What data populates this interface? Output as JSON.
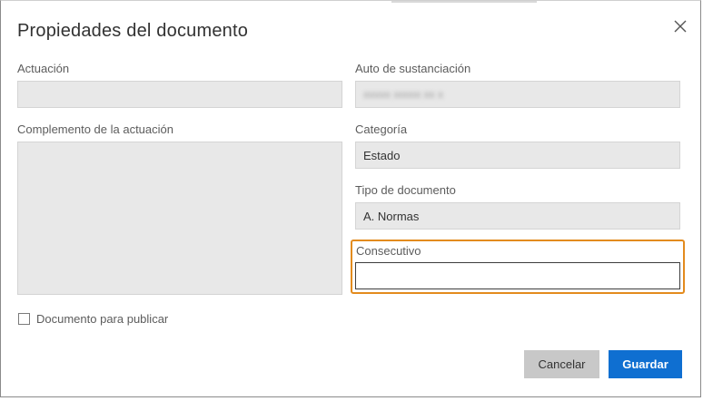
{
  "dialog": {
    "title": "Propiedades del documento"
  },
  "fields": {
    "actuacion": {
      "label": "Actuación",
      "value": ""
    },
    "auto": {
      "label": "Auto de sustanciación",
      "value": "xxxxx xxxxx xx x"
    },
    "complemento": {
      "label": "Complemento de la actuación",
      "value": ""
    },
    "categoria": {
      "label": "Categoría",
      "value": "Estado"
    },
    "tipo": {
      "label": "Tipo de documento",
      "value": "A. Normas"
    },
    "consecutivo": {
      "label": "Consecutivo",
      "value": ""
    }
  },
  "checkbox": {
    "label": "Documento para publicar",
    "checked": false
  },
  "buttons": {
    "cancel": "Cancelar",
    "save": "Guardar"
  },
  "colors": {
    "primary": "#0f6fd1",
    "highlight": "#e38b1e",
    "readonly_bg": "#e8e8e8"
  },
  "icons": {
    "close": "close-icon"
  }
}
